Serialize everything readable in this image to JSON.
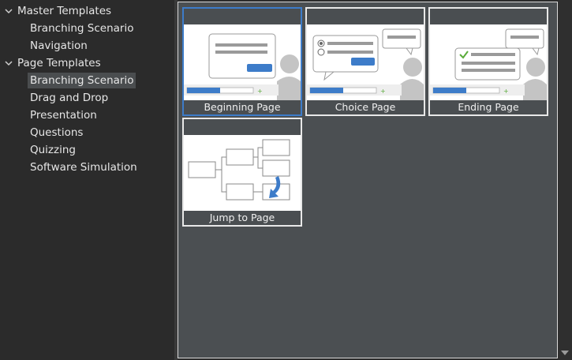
{
  "sidebar": {
    "groups": [
      {
        "label": "Master Templates",
        "items": [
          "Branching Scenario",
          "Navigation"
        ]
      },
      {
        "label": "Page Templates",
        "items": [
          "Branching Scenario",
          "Drag and Drop",
          "Presentation",
          "Questions",
          "Quizzing",
          "Software Simulation"
        ],
        "selected_index": 0
      }
    ]
  },
  "gallery": {
    "cards": [
      {
        "label": "Beginning Page",
        "icon": "beginning-page-thumbnail",
        "selected": true
      },
      {
        "label": "Choice Page",
        "icon": "choice-page-thumbnail",
        "selected": false
      },
      {
        "label": "Ending Page",
        "icon": "ending-page-thumbnail",
        "selected": false
      },
      {
        "label": "Jump to Page",
        "icon": "jump-to-page-thumbnail",
        "selected": false
      }
    ]
  },
  "colors": {
    "accent": "#3d7cc9",
    "panel": "#4b4f52",
    "sidebar": "#2b2b2b",
    "selection": "#4a4d4f",
    "checkmark": "#5aab3a"
  }
}
